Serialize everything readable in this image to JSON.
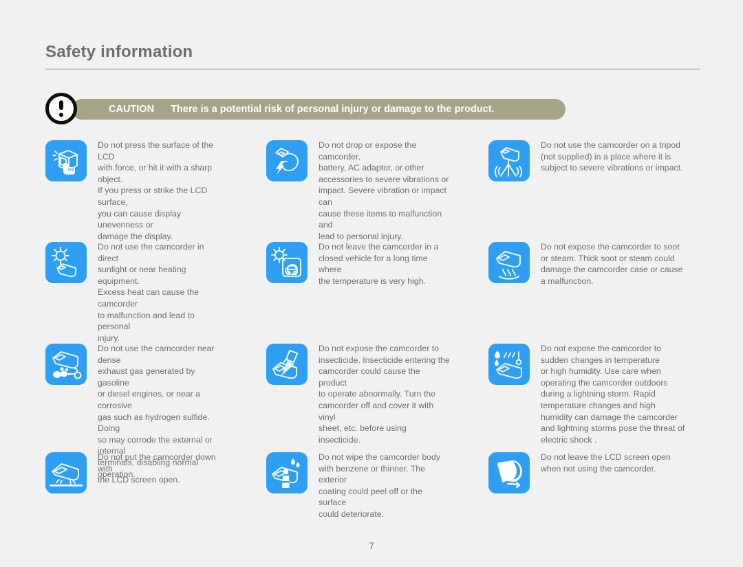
{
  "header": {
    "title": "Safety information"
  },
  "caution": {
    "icon": "exclamation-circle-icon",
    "label": "CAUTION",
    "text": "There is a potential risk of personal injury or damage to the product.",
    "bar_color": "#a5a487",
    "text_color": "#ffffff"
  },
  "theme": {
    "background": "#f1f1f1",
    "tile_blue": "#2f9ff4",
    "body_text": "#6d6e71",
    "rule": "#808285"
  },
  "items": [
    {
      "icon": "lcd-press-finger-icon",
      "text": "Do not press the surface of the LCD\nwith force, or hit it with a sharp object.\nIf you press or strike the LCD surface,\nyou can cause display unevenness or\ndamage the display."
    },
    {
      "icon": "camcorder-drop-impact-icon",
      "text": "Do not drop or expose the camcorder,\nbattery, AC adaptor, or other\naccessories to severe vibrations or\nimpact. Severe vibration or impact can\ncause these items to malfunction and\nlead to personal injury."
    },
    {
      "icon": "camcorder-tripod-vibration-icon",
      "text": "Do not use the camcorder on a tripod\n(not supplied) in a place where it is\nsubject to severe vibrations or impact."
    },
    {
      "icon": "camcorder-sun-heat-icon",
      "text": "Do not use the camcorder in direct\nsunlight or near heating equipment.\nExcess heat can cause the camcorder\nto malfunction and lead to personal\ninjury."
    },
    {
      "icon": "camcorder-in-car-sun-icon",
      "text": "Do not leave the camcorder in a\nclosed vehicle for a long time where\nthe temperature is very high."
    },
    {
      "icon": "camcorder-soot-steam-icon",
      "text": "Do not expose the camcorder to soot\nor steam. Thick soot or steam could\ndamage the camcorder case or cause\na malfunction."
    },
    {
      "icon": "camcorder-exhaust-gas-icon",
      "text": "Do not use the camcorder near dense\nexhaust gas generated by gasoline\nor diesel engines, or near a corrosive\ngas such as hydrogen sulfide. Doing\nso may corrode the external or internal\nterminals, disabling normal operation."
    },
    {
      "icon": "camcorder-insecticide-spray-icon",
      "text": "Do not expose the camcorder to\ninsecticide. Insecticide entering the\ncamcorder could cause the product\nto operate abnormally. Turn the\ncamcorder off and cover it with vinyl\nsheet, etc. before using insecticide."
    },
    {
      "icon": "camcorder-temperature-humidity-icon",
      "text": "Do not expose the camcorder to\nsudden changes in temperature\nor high humidity. Use care when\noperating the camcorder outdoors\nduring a lightning storm. Rapid\ntemperature changes and high\nhumidity can damage the camcorder\nand lightning storms pose the threat of\nelectric shock ."
    },
    {
      "icon": "camcorder-lcd-down-icon",
      "text": "Do not put the camcorder down with\nthe LCD screen open."
    },
    {
      "icon": "camcorder-benzene-thinner-icon",
      "text": "Do not wipe the camcorder body\nwith benzene or thinner. The exterior\ncoating could peel off or the surface\ncould deteriorate."
    },
    {
      "icon": "camcorder-close-lcd-icon",
      "text": "Do not leave the LCD screen open\nwhen not using the camcorder."
    }
  ],
  "footer": {
    "page_number": "7"
  }
}
